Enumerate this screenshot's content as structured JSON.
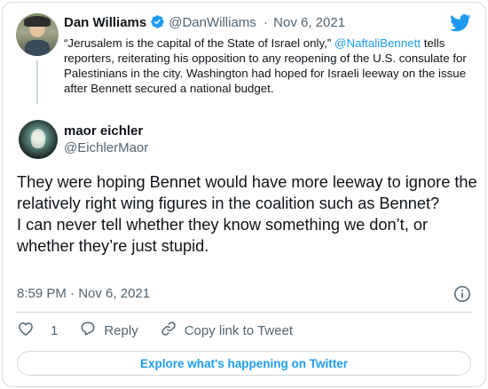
{
  "parent_tweet": {
    "author_name": "Dan Williams",
    "author_handle": "@DanWilliams",
    "separator": "·",
    "date": "Nov 6, 2021",
    "text_before_mention": "“Jerusalem is the capital of the State of Israel only,” ",
    "mention": "@NaftaliBennett",
    "text_after_mention": " tells reporters, reiterating his opposition to any reopening of the U.S. consulate for Palestinians in the city. Washington had hoped for Israeli leeway on the issue after Bennett secured a national budget.",
    "verified": true
  },
  "tweet": {
    "author_name": "maor eichler",
    "author_handle": "@EichlerMaor",
    "text_line1": "They were hoping Bennet would have more leeway to ignore the relatively right wing figures in the coalition such as Bennet?",
    "text_line2": "I can never tell whether they know something we don’t, or whether they’re just stupid.",
    "time": "8:59 PM",
    "separator": "·",
    "date": "Nov 6, 2021"
  },
  "actions": {
    "like_count": "1",
    "reply_label": "Reply",
    "copy_link_label": "Copy link to Tweet"
  },
  "footer": {
    "explore_label": "Explore what's happening on Twitter"
  },
  "colors": {
    "accent": "#1d9bf0",
    "text": "#0f1419",
    "muted": "#536471",
    "border": "#cfd9de"
  },
  "icons": [
    "verified-badge-icon",
    "twitter-bird-icon",
    "info-icon",
    "heart-icon",
    "reply-icon",
    "link-icon"
  ]
}
